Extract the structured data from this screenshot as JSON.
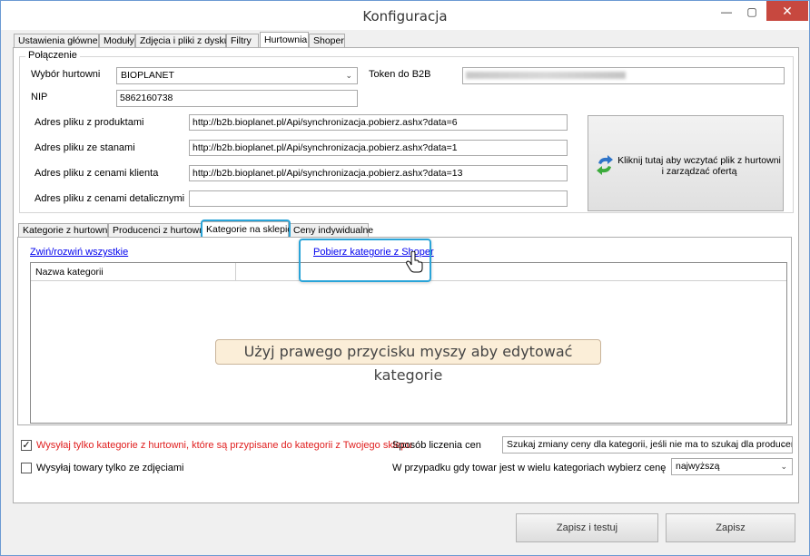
{
  "window": {
    "title": "Konfiguracja",
    "minimize_icon": "minimize-icon",
    "maximize_icon": "maximize-icon",
    "close_icon": "close-icon",
    "close_color": "#c7483f"
  },
  "main_tabs": [
    {
      "label": "Ustawienia główne"
    },
    {
      "label": "Moduły"
    },
    {
      "label": "Zdjęcia i pliki z dysku"
    },
    {
      "label": "Filtry"
    },
    {
      "label": "Hurtownia"
    },
    {
      "label": "Shoper"
    }
  ],
  "connection": {
    "legend": "Połączenie",
    "wholesaler_label": "Wybór hurtowni",
    "wholesaler_value": "BIOPLANET",
    "token_label": "Token do B2B",
    "token_value": "",
    "nip_label": "NIP",
    "nip_value": "5862160738",
    "products_label": "Adres pliku z produktami",
    "products_value": "http://b2b.bioplanet.pl/Api/synchronizacja.pobierz.ashx?data=6",
    "stock_label": "Adres pliku ze stanami",
    "stock_value": "http://b2b.bioplanet.pl/Api/synchronizacja.pobierz.ashx?data=1",
    "client_prices_label": "Adres pliku z cenami klienta",
    "client_prices_value": "http://b2b.bioplanet.pl/Api/synchronizacja.pobierz.ashx?data=13",
    "retail_prices_label": "Adres pliku z cenami detalicznymi",
    "retail_prices_value": "",
    "load_button_label": "Kliknij tutaj aby wczytać plik z hurtowni i zarządzać ofertą"
  },
  "sub_tabs": [
    {
      "label": "Kategorie z hurtowni"
    },
    {
      "label": "Producenci z hurtowni"
    },
    {
      "label": "Kategorie na sklepie"
    },
    {
      "label": "Ceny indywidualne"
    }
  ],
  "categories": {
    "collapse_link": "Zwiń/rozwiń wszystkie",
    "fetch_link": "Pobierz kategorie z Shoper",
    "column_header": "Nazwa kategorii",
    "hint": "Użyj prawego przycisku myszy aby edytować kategorie",
    "cursor_icon": "hand-cursor-icon",
    "highlight_color": "#2aa4d8"
  },
  "options": {
    "send_assigned_checked": true,
    "send_assigned_label": "Wysyłaj tylko kategorie z hurtowni, które są przypisane do kategorii z Twojego sklepu",
    "send_assigned_color": "#e02020",
    "only_with_photos_checked": false,
    "only_with_photos_label": "Wysyłaj towary tylko ze zdjęciami",
    "price_method_label": "Sposób liczenia cen",
    "price_method_value": "Szukaj zmiany ceny dla kategorii, jeśli nie ma to szukaj dla producenta",
    "multi_category_label": "W przypadku gdy towar jest w wielu kategoriach wybierz cenę",
    "multi_category_value": "najwyższą"
  },
  "footer": {
    "save_test_label": "Zapisz i testuj",
    "save_label": "Zapisz"
  }
}
